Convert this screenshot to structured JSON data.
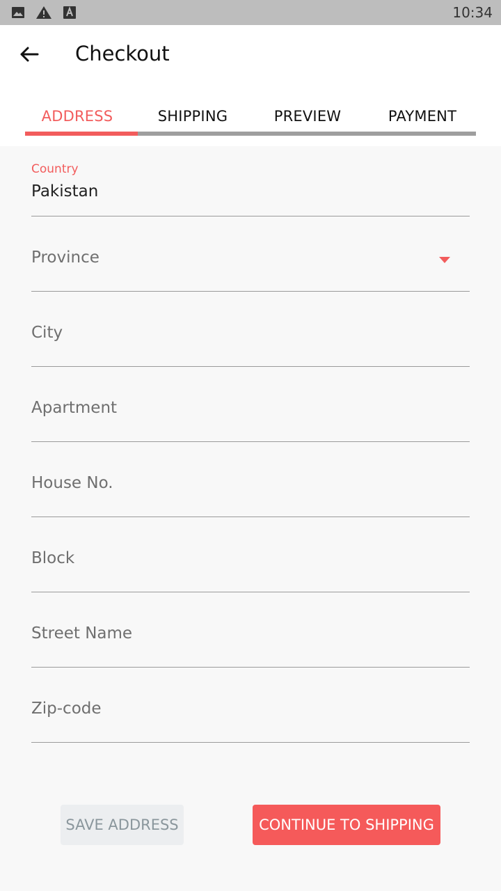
{
  "status_bar": {
    "time": "10:34",
    "icons": [
      "image-icon",
      "warning-icon",
      "text-a-icon"
    ]
  },
  "header": {
    "back_icon": "arrow-left-icon",
    "title": "Checkout"
  },
  "tabs": [
    {
      "label": "ADDRESS",
      "active": true
    },
    {
      "label": "SHIPPING",
      "active": false
    },
    {
      "label": "PREVIEW",
      "active": false
    },
    {
      "label": "PAYMENT",
      "active": false
    }
  ],
  "form": {
    "country": {
      "label": "Country",
      "value": "Pakistan"
    },
    "province": {
      "placeholder": "Province",
      "icon": "dropdown-arrow-icon"
    },
    "city": {
      "placeholder": "City"
    },
    "apartment": {
      "placeholder": "Apartment"
    },
    "house_no": {
      "placeholder": "House No."
    },
    "block": {
      "placeholder": "Block"
    },
    "street_name": {
      "placeholder": "Street Name"
    },
    "zip_code": {
      "placeholder": "Zip-code"
    }
  },
  "actions": {
    "save_label": "SAVE ADDRESS",
    "continue_label": "CONTINUE TO SHIPPING"
  },
  "colors": {
    "accent": "#f25c5c",
    "status_bar": "#bdbdbd",
    "background": "#f8f8f8"
  }
}
